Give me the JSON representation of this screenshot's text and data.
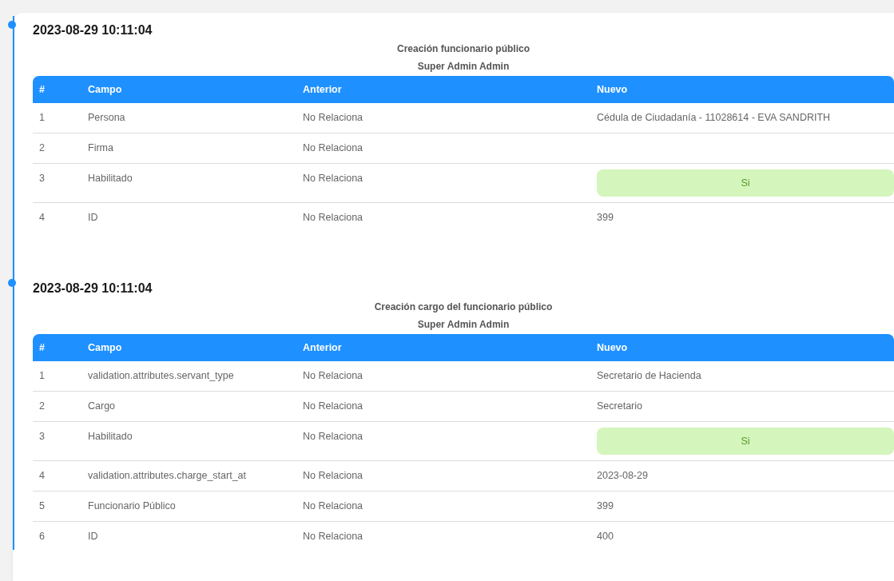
{
  "entries": [
    {
      "date": "2023-08-29 10:11:04",
      "action": "Creación funcionario público",
      "user": "Super Admin Admin",
      "columns": [
        "#",
        "Campo",
        "Anterior",
        "Nuevo"
      ],
      "rows": [
        {
          "n": "1",
          "campo": "Persona",
          "anterior": "No Relaciona",
          "nuevo": "Cédula de Ciudadanía - 11028614 - EVA SANDRITH",
          "kind": "text"
        },
        {
          "n": "2",
          "campo": "Firma",
          "anterior": "No Relaciona",
          "kind": "text"
        },
        {
          "n": "3",
          "campo": "Habilitado",
          "anterior": "No Relaciona",
          "nuevo": "Si",
          "kind": "badge"
        },
        {
          "n": "4",
          "campo": "ID",
          "anterior": "No Relaciona",
          "nuevo": "399",
          "kind": "text"
        }
      ]
    },
    {
      "date": "2023-08-29 10:11:04",
      "action": "Creación cargo del funcionario público",
      "user": "Super Admin Admin",
      "columns": [
        "#",
        "Campo",
        "Anterior",
        "Nuevo"
      ],
      "rows": [
        {
          "n": "1",
          "campo": "validation.attributes.servant_type",
          "anterior": "No Relaciona",
          "nuevo": "Secretario de Hacienda",
          "kind": "text"
        },
        {
          "n": "2",
          "campo": "Cargo",
          "anterior": "No Relaciona",
          "nuevo": "Secretario",
          "kind": "text"
        },
        {
          "n": "3",
          "campo": "Habilitado",
          "anterior": "No Relaciona",
          "nuevo": "Si",
          "kind": "badge"
        },
        {
          "n": "4",
          "campo": "validation.attributes.charge_start_at",
          "anterior": "No Relaciona",
          "nuevo": "2023-08-29",
          "kind": "text"
        },
        {
          "n": "5",
          "campo": "Funcionario Público",
          "anterior": "No Relaciona",
          "nuevo": "399",
          "kind": "text"
        },
        {
          "n": "6",
          "campo": "ID",
          "anterior": "No Relaciona",
          "nuevo": "400",
          "kind": "text"
        }
      ]
    }
  ]
}
